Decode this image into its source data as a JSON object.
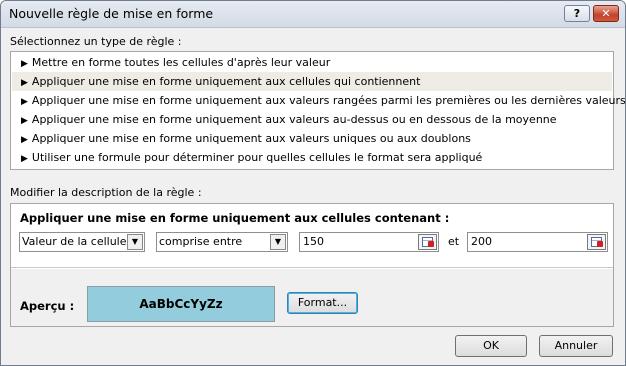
{
  "window": {
    "title": "Nouvelle règle de mise en forme",
    "help_label": "?",
    "close_label": "✕"
  },
  "rule_type": {
    "label": "Sélectionnez un type de règle :",
    "items": [
      "Mettre en forme toutes les cellules d'après leur valeur",
      "Appliquer une mise en forme uniquement aux cellules qui contiennent",
      "Appliquer une mise en forme uniquement aux valeurs rangées parmi les premières ou les dernières valeurs",
      "Appliquer une mise en forme uniquement aux valeurs au-dessus ou en dessous de la moyenne",
      "Appliquer une mise en forme uniquement aux valeurs uniques ou aux doublons",
      "Utiliser une formule pour déterminer pour quelles cellules le format sera appliqué"
    ],
    "selected_index": 1
  },
  "description": {
    "label": "Modifier la description de la règle :",
    "heading": "Appliquer une mise en forme uniquement aux cellules contenant :",
    "cell_type": "Valeur de la cellule",
    "operator": "comprise entre",
    "value1": "150",
    "and_label": "et",
    "value2": "200",
    "preview_label": "Aperçu :",
    "preview_text": "AaBbCcYyZz",
    "preview_color": "#93cddd",
    "format_button": "Format..."
  },
  "buttons": {
    "ok": "OK",
    "cancel": "Annuler"
  }
}
